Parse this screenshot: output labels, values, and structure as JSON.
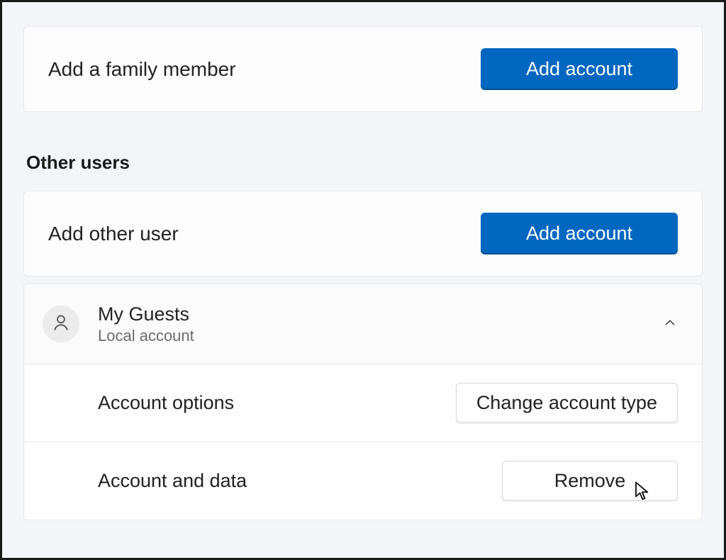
{
  "family": {
    "add_label": "Add a family member",
    "add_button": "Add account"
  },
  "other_users": {
    "heading": "Other users",
    "add_label": "Add other user",
    "add_button": "Add account"
  },
  "user": {
    "name": "My Guests",
    "type": "Local account",
    "options_label": "Account options",
    "change_type_button": "Change account type",
    "data_label": "Account and data",
    "remove_button": "Remove"
  }
}
